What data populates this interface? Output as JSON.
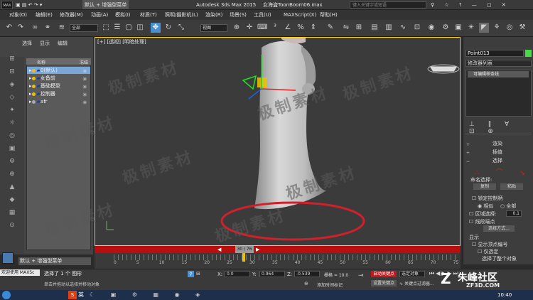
{
  "titlebar": {
    "logo": "MAX",
    "workspace": "默认 + 增强型菜单",
    "app": "Autodesk 3ds Max  2015",
    "file": "女海盗ToonBoom06.max",
    "search_placeholder": "键入关键字或短语"
  },
  "menu": [
    "对象(O)",
    "编辑(E)",
    "修改器(M)",
    "动画(A)",
    "模拟(I)",
    "材质(T)",
    "照明/摄影机(L)",
    "渲染(R)",
    "场景(S)",
    "工具(U)",
    "MAXScript(X)",
    "帮助(H)"
  ],
  "toolbar": {
    "selection_filter": "全部",
    "ref_coord": "视图"
  },
  "left_panel": {
    "tabs": [
      "选择",
      "显示",
      "编辑"
    ],
    "columns": [
      "名称",
      "冻结"
    ],
    "layers": [
      "0(默认)",
      "女备前",
      "基础模型",
      "控制器",
      "afr"
    ]
  },
  "viewport": {
    "label": "[+] [透视] [明暗处理]",
    "frame": "30 / 76"
  },
  "watermark": "极制素材",
  "right_panel": {
    "object_name": "Point013",
    "modifier_list": "修改器列表",
    "stack_item": "可编辑样条线",
    "rollouts": [
      "渲染",
      "插值",
      "选择"
    ],
    "named_sel": "命名选择:",
    "copy": "复制",
    "paste": "粘贴",
    "lock_handles": "锁定控制柄",
    "similar": "相似",
    "all": "全部",
    "area_sel": "区域选择:",
    "area_val": "0.1",
    "seg_end": "线段端点",
    "select_by": "选择方式...",
    "display": "显示",
    "show_vert_nums": "显示顶点编号",
    "sel_only": "仅选定",
    "sel_count": "选择了整个对象"
  },
  "timeline": {
    "ticks": [
      "0",
      "5",
      "10",
      "15",
      "20",
      "25",
      "30",
      "35",
      "40",
      "45",
      "50",
      "55",
      "60",
      "65",
      "70",
      "75"
    ]
  },
  "status": {
    "workspace": "默认 + 增强型菜单",
    "msg1": "选择了 1 个 图形",
    "msg2": "单击并拖动以选择并移动对象",
    "x_label": "X:",
    "x": "0.0",
    "y_label": "Y:",
    "y": "0.964",
    "z_label": "Z:",
    "z": "-0.539",
    "grid": "栅格 = 10.0",
    "auto_key": "自动关键点",
    "set_key": "设置关键点",
    "sel_obj": "选定对象",
    "key_filters": "关键点过滤器...",
    "add_time_tag": "添加时间标记",
    "welcome": "欢迎使用 MAXSc"
  },
  "taskbar": {
    "ime": "英",
    "time": "10:40"
  },
  "brand": {
    "name": "朱峰社区",
    "site": "ZF3D.COM"
  },
  "colors": {
    "accent_red": "#c0181e",
    "viewport_border": "#ffd21a",
    "spline_red": "#d0202a"
  }
}
